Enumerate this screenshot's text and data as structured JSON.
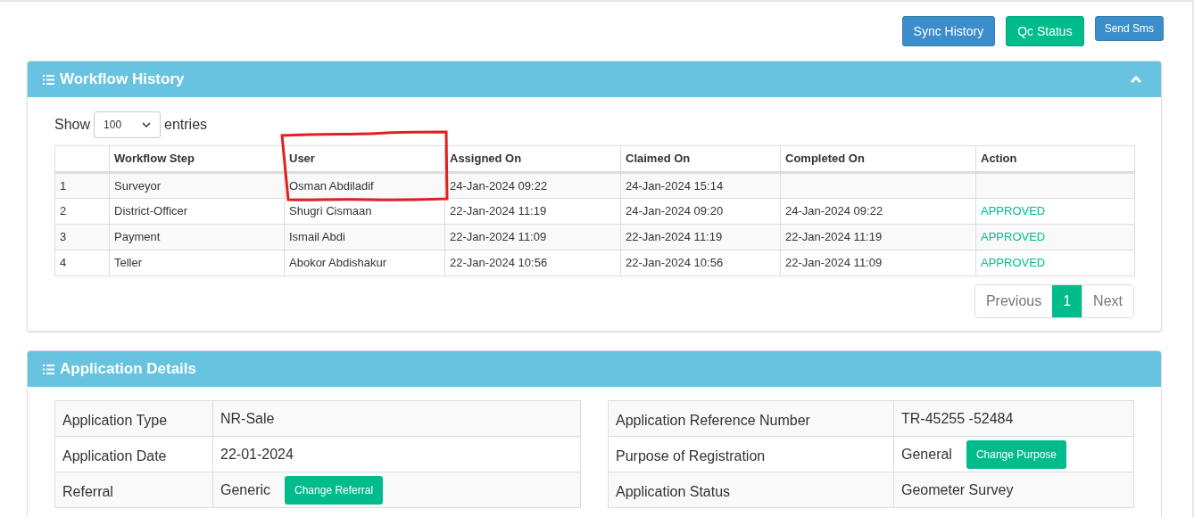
{
  "actions": [
    {
      "label": "Sync History",
      "kind": "primary"
    },
    {
      "label": "Qc Status",
      "kind": "success"
    },
    {
      "label": "Send Sms",
      "kind": "primary-small"
    }
  ],
  "workflow_panel": {
    "title": "Workflow History",
    "expanded": true,
    "length_menu": {
      "before": "Show",
      "value": "100",
      "after": "entries"
    },
    "columns": [
      "Workflow Step",
      "User",
      "Assigned On",
      "Claimed On",
      "Completed On",
      "Action"
    ],
    "rows": [
      {
        "no": "1",
        "step": "Surveyor",
        "user": "Osman Abdiladif",
        "assigned_on": "24-Jan-2024 09:22",
        "claimed_on": "24-Jan-2024 15:14"
      },
      {
        "no": "2",
        "step": "District-Officer",
        "user": "Shugri Cismaan",
        "assigned_on": "22-Jan-2024 11:19",
        "claimed_on": "24-Jan-2024 09:20",
        "completed_on": "24-Jan-2024 09:22",
        "action": "APPROVED"
      },
      {
        "no": "3",
        "step": "Payment",
        "user": "Ismail Abdi",
        "assigned_on": "22-Jan-2024 11:09",
        "claimed_on": "22-Jan-2024 11:19",
        "completed_on": "22-Jan-2024 11:19",
        "action": "APPROVED"
      },
      {
        "no": "4",
        "step": "Teller",
        "user": "Abokor Abdishakur",
        "assigned_on": "22-Jan-2024 10:56",
        "claimed_on": "22-Jan-2024 10:56",
        "completed_on": "22-Jan-2024 11:09",
        "action": "APPROVED"
      }
    ],
    "pagination": {
      "previous": "Previous",
      "pages": [
        {
          "label": "1",
          "selected": true
        }
      ],
      "next": "Next"
    }
  },
  "details_panel": {
    "title": "Application Details",
    "left": [
      {
        "label": "Application Type",
        "value": "NR-Sale"
      },
      {
        "label": "Application Date",
        "value": "22-01-2024"
      },
      {
        "label": "Referral",
        "value": "Generic",
        "button": "Change Referral"
      }
    ],
    "right": [
      {
        "label": "Application Reference Number",
        "value": "TR-45255 -52484"
      },
      {
        "label": "Purpose of Registration",
        "value": "General",
        "button": "Change Purpose"
      },
      {
        "label": "Application Status",
        "value": "Geometer Survey"
      }
    ]
  }
}
